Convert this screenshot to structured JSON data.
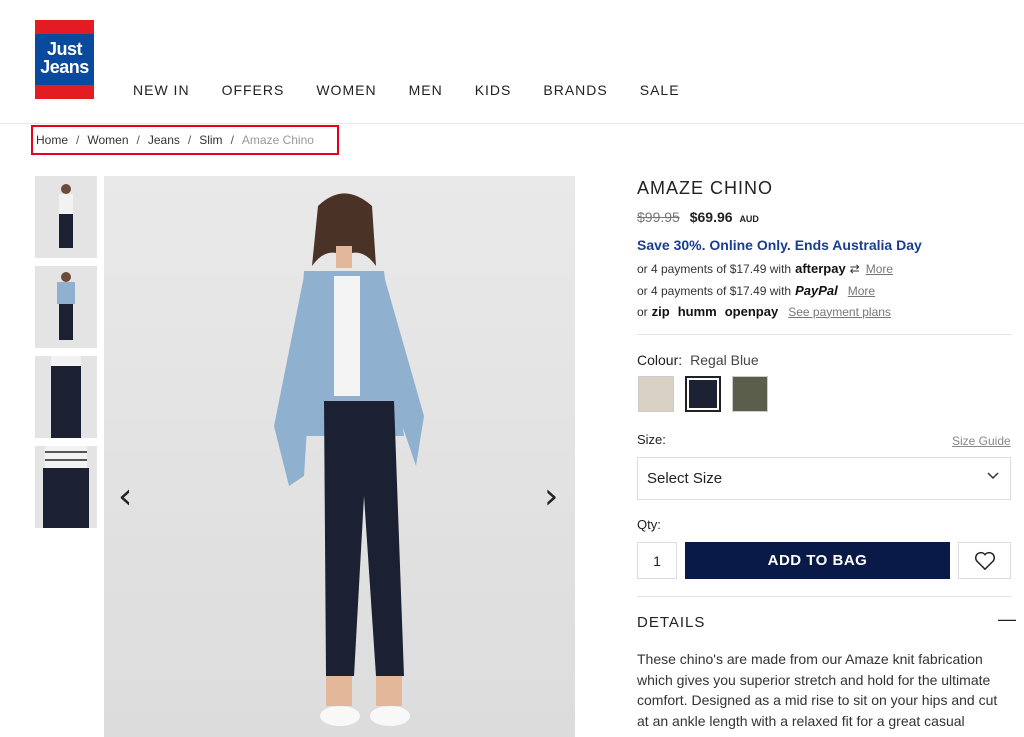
{
  "brand": {
    "logo_text": "Just Jeans"
  },
  "nav": {
    "items": [
      "NEW IN",
      "OFFERS",
      "WOMEN",
      "MEN",
      "KIDS",
      "BRANDS",
      "SALE"
    ]
  },
  "breadcrumb": {
    "items": [
      "Home",
      "Women",
      "Jeans",
      "Slim"
    ],
    "current": "Amaze Chino",
    "separator": "/"
  },
  "product": {
    "title": "AMAZE CHINO",
    "was_price": "$99.95",
    "price": "$69.96",
    "currency": "AUD",
    "promo": "Save 30%. Online Only. Ends Australia Day",
    "payments": {
      "afterpay_text": "or 4 payments of $17.49 with",
      "afterpay_brand": "afterpay",
      "paypal_text": "or 4 payments of $17.49 with",
      "paypal_brand": "PayPal",
      "more": "More",
      "or": "or",
      "zip": "zip",
      "humm": "humm",
      "openpay": "openpay",
      "plans": "See payment plans"
    },
    "colour_label": "Colour:",
    "colour_value": "Regal Blue",
    "swatches": [
      {
        "name": "stone",
        "color": "#d9d1c4"
      },
      {
        "name": "regal-blue",
        "color": "#1c2233"
      },
      {
        "name": "khaki",
        "color": "#5a5e4a"
      }
    ],
    "size_label": "Size:",
    "size_guide": "Size Guide",
    "size_select": "Select Size",
    "qty_label": "Qty:",
    "qty_value": "1",
    "add_to_bag": "ADD TO BAG",
    "details_heading": "DETAILS",
    "description": "These chino's are made from our Amaze knit fabrication which gives you superior stretch and hold for the ultimate comfort. Designed as a mid rise to sit on your hips and cut at an ankle length with a relaxed fit for a great casual"
  }
}
